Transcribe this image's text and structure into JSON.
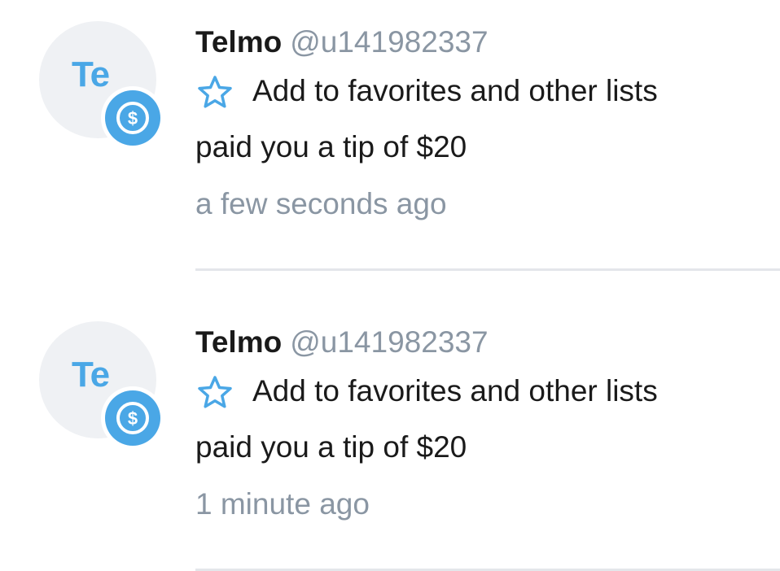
{
  "notifications": [
    {
      "avatar_initials": "Te",
      "name": "Telmo",
      "handle": "@u141982337",
      "favorite_label": "Add to favorites and other lists",
      "message": "paid you a tip of $20",
      "time": "a few seconds ago",
      "badge_icon": "dollar-icon",
      "favorite_icon": "star-outline-icon"
    },
    {
      "avatar_initials": "Te",
      "name": "Telmo",
      "handle": "@u141982337",
      "favorite_label": "Add to favorites and other lists",
      "message": "paid you a tip of $20",
      "time": "1 minute ago",
      "badge_icon": "dollar-icon",
      "favorite_icon": "star-outline-icon"
    }
  ],
  "colors": {
    "accent": "#4aa7e6",
    "avatar_bg": "#eff1f4",
    "secondary_text": "#8a96a3",
    "primary_text": "#1a1a1a",
    "divider": "#e4e6ea"
  }
}
